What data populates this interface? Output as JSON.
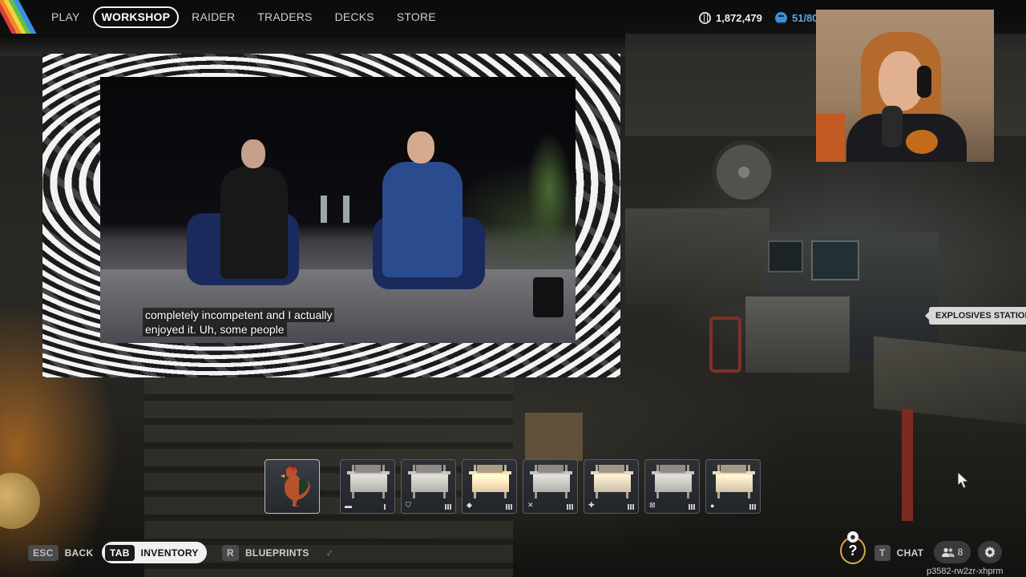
{
  "nav": {
    "items": [
      {
        "label": "PLAY"
      },
      {
        "label": "WORKSHOP",
        "active": true
      },
      {
        "label": "RAIDER"
      },
      {
        "label": "TRADERS"
      },
      {
        "label": "DECKS"
      },
      {
        "label": "STORE"
      }
    ],
    "coins": "1,872,479",
    "tokens": "51/80"
  },
  "video": {
    "subtitle_line1": "completely incompetent and I actually",
    "subtitle_line2": "enjoyed it. Uh, some people"
  },
  "tooltip": {
    "label": "EXPLOSIVES STATION"
  },
  "inventory": {
    "slots": [
      {
        "name": "rooster",
        "icon": "rooster-icon"
      },
      {
        "name": "workbench",
        "icon": "bench-icon",
        "level": 1
      },
      {
        "name": "gear-bench",
        "icon": "shield-icon",
        "level": 3
      },
      {
        "name": "refiner",
        "icon": "refiner-icon",
        "level": 3
      },
      {
        "name": "weapon-bench",
        "icon": "crossed-tools-icon",
        "level": 3
      },
      {
        "name": "medical-lab",
        "icon": "plus-icon",
        "level": 3
      },
      {
        "name": "explosives-station",
        "icon": "explosive-icon",
        "level": 3
      },
      {
        "name": "utility-station",
        "icon": "utility-icon",
        "level": 3
      }
    ]
  },
  "bottom": {
    "esc_key": "ESC",
    "back_label": "BACK",
    "tab_key": "TAB",
    "inventory_label": "INVENTORY",
    "r_key": "R",
    "blueprints_label": "BLUEPRINTS",
    "t_key": "T",
    "chat_label": "CHAT",
    "friends_count": "8",
    "help_label": "?",
    "session_id": "p3582-rw2zr-xhprm"
  },
  "colors": {
    "accent_gold": "#d8a94a",
    "token_blue": "#5aa8e6"
  }
}
